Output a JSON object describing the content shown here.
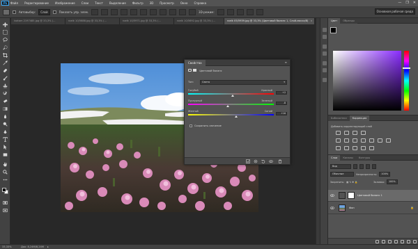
{
  "menu": {
    "logo": "Ps",
    "items": [
      "Файл",
      "Редактирование",
      "Изображение",
      "Слои",
      "Текст",
      "Выделение",
      "Фильтр",
      "3D",
      "Просмотр",
      "Окно",
      "Справка"
    ]
  },
  "window_controls": [
    "—",
    "❐",
    "✕"
  ],
  "options_bar": {
    "autoselect_label": "Автовыбор:",
    "autoselect_value": "Слой",
    "show_controls_label": "Показать упр. элем.",
    "mode_3d": "3D-режим:",
    "workspace": "Основная рабочая среда"
  },
  "tabs": [
    {
      "label": "ivatam 2197485.jpg @ 33,3% (...",
      "active": false
    },
    {
      "label": "roelk 10/5688.jpg @ 33,3% (...",
      "active": false
    },
    {
      "label": "roelk 10/5971.jpg @ 33,3% (...",
      "active": false
    },
    {
      "label": "roelk 10/5692.jpg @ 33,3% (...",
      "active": false
    },
    {
      "label": "roelk 05/5939.jpg @ 33,3% (Цветовой баланс 1, Слой-маска/8)",
      "active": true
    }
  ],
  "properties": {
    "tab": "Свойства",
    "adjustment_name": "Цветовой баланс",
    "tone_label": "Тон:",
    "tone_value": "Света",
    "sliders": [
      {
        "left": "Голубой",
        "right": "Красный",
        "value": "+2",
        "level": 0.52,
        "gradient": [
          "#00ffff",
          "#ff0000"
        ]
      },
      {
        "left": "Пурпурный",
        "right": "Зеленый",
        "value": "-8",
        "level": 0.46,
        "gradient": [
          "#ff00ff",
          "#00ff00"
        ]
      },
      {
        "left": "Желтый",
        "right": "Синий",
        "value": "+16",
        "level": 0.56,
        "gradient": [
          "#ffff00",
          "#0000ff"
        ]
      }
    ],
    "preserve_luminosity": "Сохранить свечение"
  },
  "color_panel": {
    "tabs": [
      "Цвет",
      "Образцы"
    ],
    "foreground": "#000000",
    "background": "#ffffff"
  },
  "adjustments_panel": {
    "tabs": [
      "Библиотеки",
      "Коррекция"
    ],
    "caption": "Добавить корректирующий слой"
  },
  "layers_panel": {
    "tabs": [
      "Слои",
      "Каналы",
      "Контуры"
    ],
    "filter_value": "Вид",
    "blend_mode": "Обычные",
    "opacity_label": "Непрозрачность:",
    "opacity_value": "100%",
    "lock_label": "Закрепить:",
    "fill_label": "Заливка:",
    "fill_value": "100%",
    "layers": [
      {
        "name": "Цветовой баланс 1",
        "selected": true
      },
      {
        "name": "Фон",
        "selected": false
      }
    ]
  },
  "status": {
    "zoom": "33,33%",
    "doc_info": "Док: 8,24М/8,24М"
  }
}
